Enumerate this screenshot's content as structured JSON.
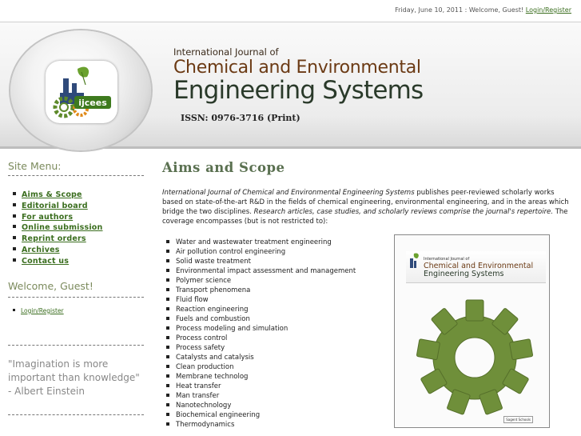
{
  "topbar": {
    "date_text": "Friday, June 10, 2011 : Welcome, Guest!",
    "login_link": "Login/Register"
  },
  "banner": {
    "logo_text": "ijcees",
    "journal_prefix": "International Journal of",
    "title_line1": "Chemical and Environmental",
    "title_line2": "Engineering Systems",
    "issn": "ISSN: 0976-3716 (Print)"
  },
  "sidebar": {
    "menu_heading": "Site Menu:",
    "menu_items": [
      {
        "label": "Aims & Scope"
      },
      {
        "label": "Editorial board"
      },
      {
        "label": "For authors"
      },
      {
        "label": "Online submission"
      },
      {
        "label": "Reprint orders"
      },
      {
        "label": "Archives"
      },
      {
        "label": "Contact us"
      }
    ],
    "welcome_heading": "Welcome, Guest!",
    "login_item": "Login/Register",
    "quote_line1": "\"Imagination is more",
    "quote_line2": "important than knowledge\"",
    "quote_line3": "- Albert Einstein"
  },
  "main": {
    "heading": "Aims and Scope",
    "intro_italic": "International Journal of Chemical and Environmental Engineering Systems",
    "intro_text": " publishes peer-reviewed scholarly works based on state-of-the-art R&D in the fields of chemical engineering, environmental engineering, and in the areas which bridge the two disciplines. ",
    "intro_italic2": "Research articles, case studies, and scholarly reviews comprise the journal's repertoire.",
    "intro_text2": " The coverage encompasses (but is not restricted to):",
    "topics": [
      "Water and wastewater treatment engineering",
      "Air pollution control engineering",
      "Solid waste treatment",
      "Environmental impact assessment and management",
      "Polymer science",
      "Transport phenomena",
      "Fluid flow",
      "Reaction engineering",
      "Fuels and combustion",
      "Process modeling and simulation",
      "Process control",
      "Process safety",
      "Catalysts and catalysis",
      "Clean production",
      "Membrane technolog",
      "Heat transfer",
      "Man transfer",
      "Nanotechnology",
      "Biochemical engineering",
      "Thermodynamics"
    ]
  },
  "cover": {
    "prefix": "International Journal of",
    "title_line1": "Chemical and Environmental",
    "title_line2": "Engineering Systems",
    "publisher": "Sagent Schools"
  },
  "colors": {
    "link_green": "#3b6e1f",
    "heading_green": "#5a7050",
    "title_brown": "#6b3a14",
    "gear_green": "#5e8a2a"
  },
  "icons": [
    "gear-icon",
    "leaf-icon",
    "factory-icon"
  ]
}
